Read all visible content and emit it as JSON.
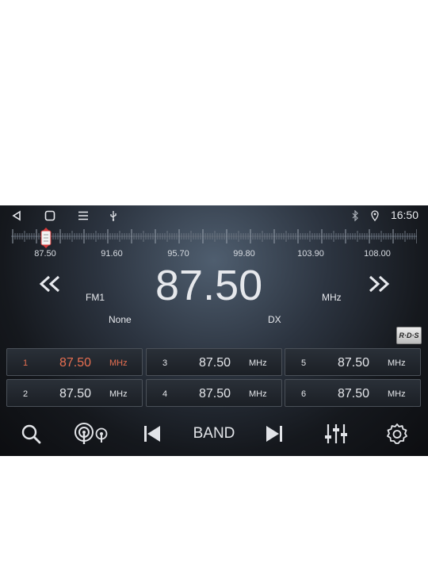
{
  "status": {
    "time": "16:50",
    "left_icons": [
      "back-triangle-icon",
      "home-square-icon",
      "menu-lines-icon",
      "usb-icon"
    ],
    "right_icons": [
      "bluetooth-icon",
      "location-pin-icon"
    ]
  },
  "tuner": {
    "scale_labels": [
      "87.50",
      "91.60",
      "95.70",
      "99.80",
      "103.90",
      "108.00"
    ],
    "frequency": "87.50",
    "band": "FM1",
    "unit": "MHz",
    "ps_name": "None",
    "mode": "DX",
    "rds_badge": "R·D·S"
  },
  "presets": [
    {
      "num": "1",
      "freq": "87.50",
      "unit": "MHz",
      "active": true
    },
    {
      "num": "3",
      "freq": "87.50",
      "unit": "MHz",
      "active": false
    },
    {
      "num": "5",
      "freq": "87.50",
      "unit": "MHz",
      "active": false
    },
    {
      "num": "2",
      "freq": "87.50",
      "unit": "MHz",
      "active": false
    },
    {
      "num": "4",
      "freq": "87.50",
      "unit": "MHz",
      "active": false
    },
    {
      "num": "6",
      "freq": "87.50",
      "unit": "MHz",
      "active": false
    }
  ],
  "controls": {
    "band_label": "BAND",
    "icons": [
      "search-icon",
      "broadcast-icon",
      "skip-previous-icon",
      "skip-next-icon",
      "equalizer-icon",
      "settings-gear-icon"
    ]
  },
  "colors": {
    "accent": "#e76f51",
    "text": "#e6e8ec"
  }
}
